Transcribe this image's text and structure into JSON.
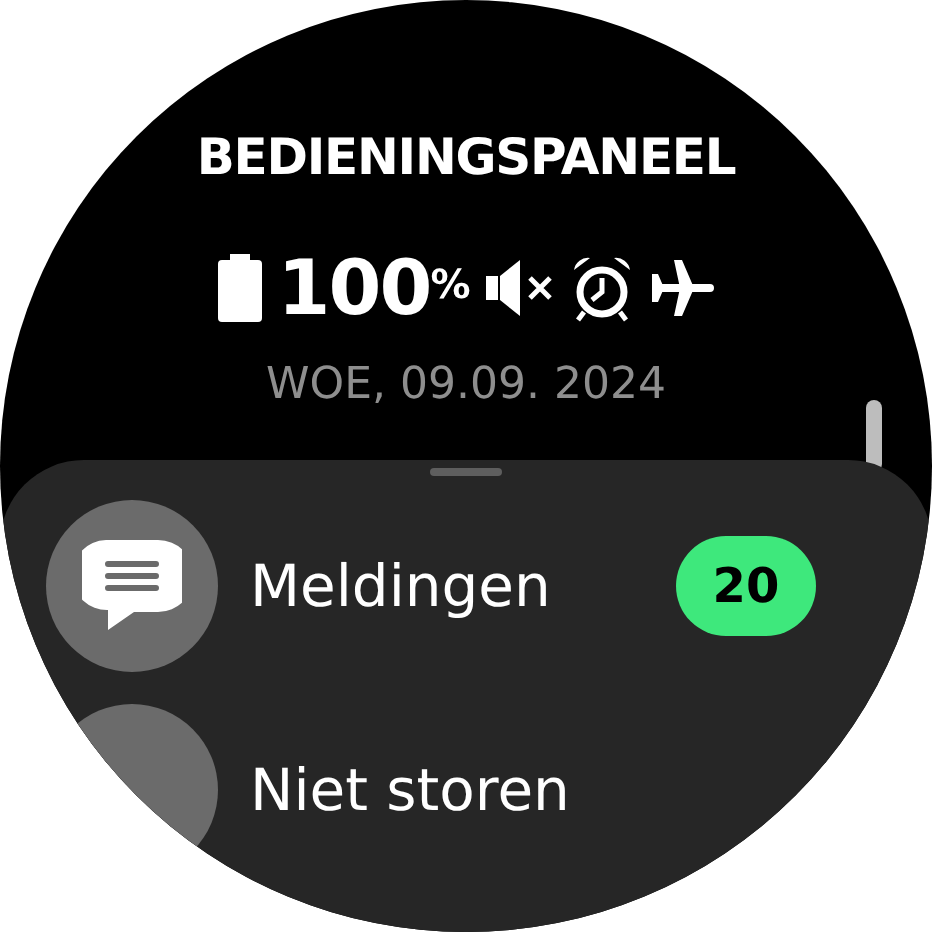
{
  "title": "BEDIENINGSPANEEL",
  "status": {
    "battery_value": "100",
    "battery_unit": "%"
  },
  "date": "WOE, 09.09. 2024",
  "items": [
    {
      "kind": "notifications",
      "label": "Meldingen",
      "badge": "20"
    },
    {
      "kind": "do_not_disturb",
      "label": "Niet storen"
    }
  ]
}
